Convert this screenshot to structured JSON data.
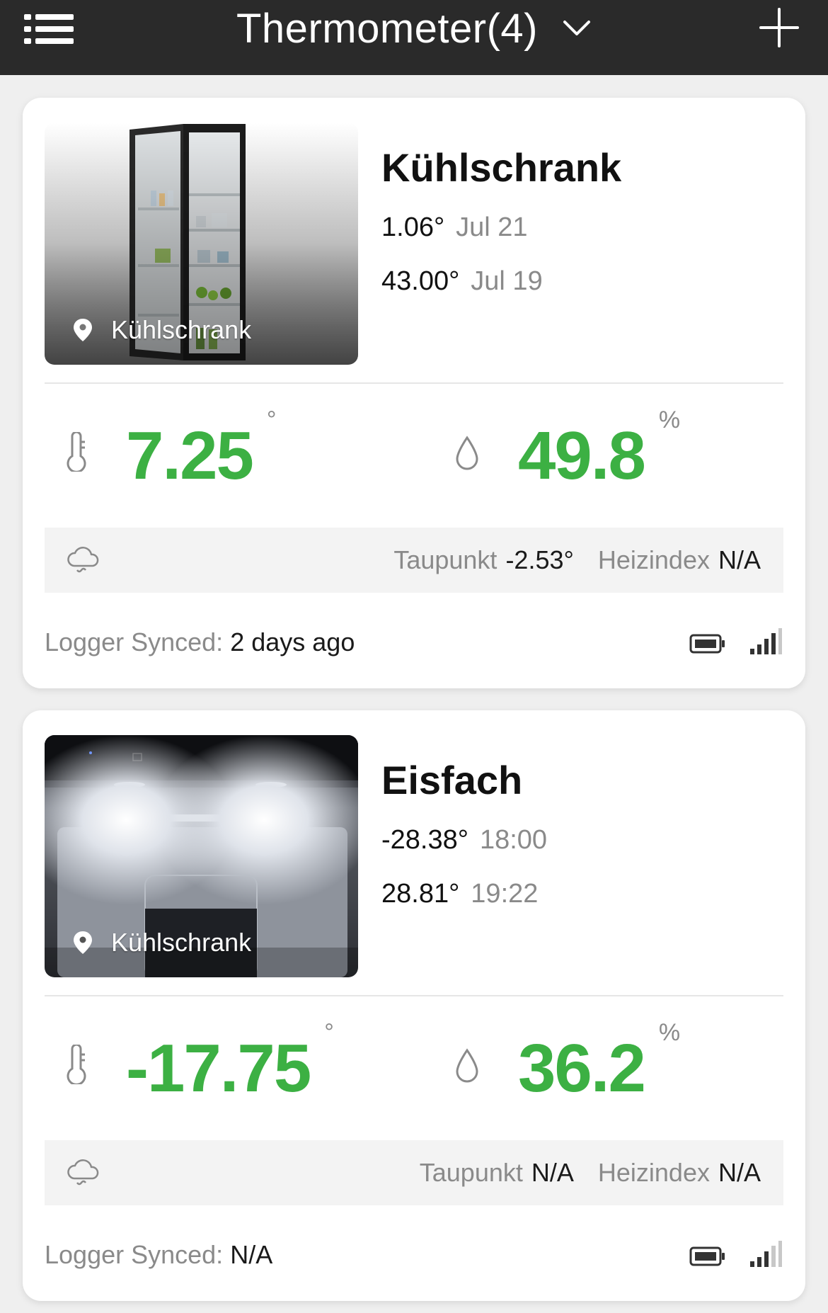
{
  "header": {
    "title": "Thermometer(4)"
  },
  "devices": [
    {
      "name": "Kühlschrank",
      "location": "Kühlschrank",
      "min_value": "1.06°",
      "min_time": "Jul 21",
      "max_value": "43.00°",
      "max_time": "Jul 19",
      "temperature": "7.25",
      "temperature_unit": "°",
      "humidity": "49.8",
      "humidity_unit": "%",
      "dewpoint_label": "Taupunkt",
      "dewpoint_value": "-2.53°",
      "heatindex_label": "Heizindex",
      "heatindex_value": "N/A",
      "sync_label": "Logger Synced:",
      "sync_value": "2 days ago"
    },
    {
      "name": "Eisfach",
      "location": "Kühlschrank",
      "min_value": "-28.38°",
      "min_time": "18:00",
      "max_value": "28.81°",
      "max_time": "19:22",
      "temperature": "-17.75",
      "temperature_unit": "°",
      "humidity": "36.2",
      "humidity_unit": "%",
      "dewpoint_label": "Taupunkt",
      "dewpoint_value": "N/A",
      "heatindex_label": "Heizindex",
      "heatindex_value": "N/A",
      "sync_label": "Logger Synced:",
      "sync_value": "N/A"
    }
  ],
  "colors": {
    "accent_green": "#3cb043",
    "header_bg": "#2a2a2a",
    "muted_text": "#8a8a8a"
  },
  "icons": [
    "menu-list-icon",
    "chevron-down-icon",
    "plus-icon",
    "location-pin-icon",
    "thermometer-icon",
    "droplet-icon",
    "cloud-icon",
    "battery-icon",
    "signal-bars-icon"
  ]
}
